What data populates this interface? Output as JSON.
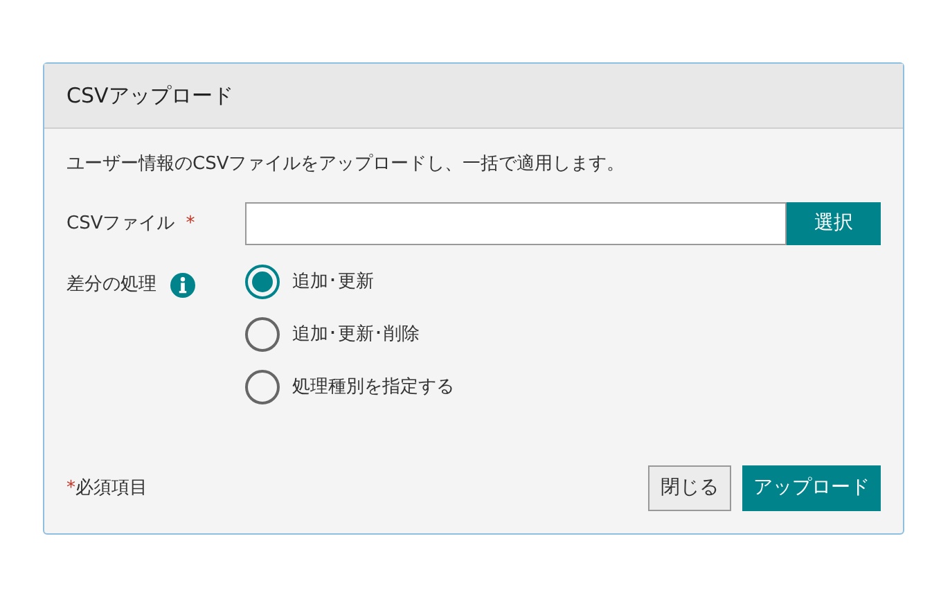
{
  "dialog": {
    "title": "CSVアップロード",
    "description": "ユーザー情報のCSVファイルをアップロードし、一括で適用します。",
    "file_field": {
      "label": "CSVファイル",
      "required": true,
      "required_mark": "*",
      "button": "選択"
    },
    "diff": {
      "label": "差分の処理",
      "options": [
        {
          "label": "追加･更新",
          "selected": true
        },
        {
          "label": "追加･更新･削除",
          "selected": false
        },
        {
          "label": "処理種別を指定する",
          "selected": false
        }
      ]
    },
    "footer": {
      "note_mark": "*",
      "note": "必須項目",
      "buttons": [
        {
          "label": "閉じる",
          "kind": "secondary"
        },
        {
          "label": "アップロード",
          "kind": "primary"
        }
      ]
    }
  }
}
